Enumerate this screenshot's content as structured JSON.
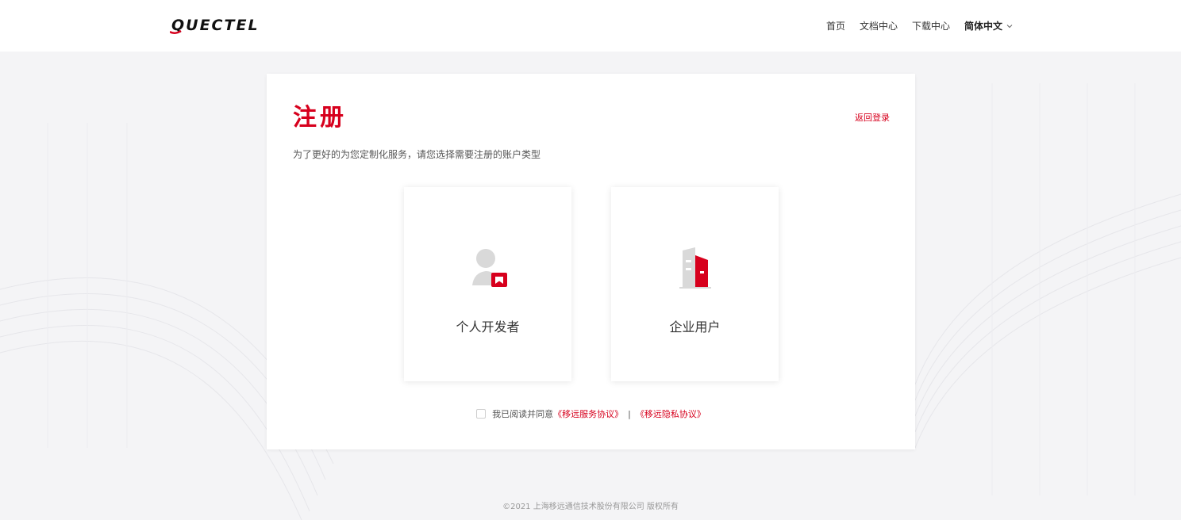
{
  "header": {
    "logo_text": "QUECTEL",
    "nav": [
      {
        "label": "首页"
      },
      {
        "label": "文档中心"
      },
      {
        "label": "下载中心"
      }
    ],
    "language": "简体中文"
  },
  "card": {
    "title": "注册",
    "back_login": "返回登录",
    "subtitle": "为了更好的为您定制化服务，请您选择需要注册的账户类型",
    "account_types": [
      {
        "label": "个人开发者",
        "icon": "user-icon"
      },
      {
        "label": "企业用户",
        "icon": "building-icon"
      }
    ],
    "agreement": {
      "prefix": "我已阅读并同意",
      "service_link": "《移远服务协议》",
      "separator": "|",
      "privacy_link": "《移远隐私协议》"
    }
  },
  "footer": {
    "copyright": "©2021 上海移远通信技术股份有限公司 版权所有"
  },
  "colors": {
    "brand_red": "#d7001d",
    "icon_gray": "#d9d9d9",
    "page_bg": "#f4f4f6"
  }
}
